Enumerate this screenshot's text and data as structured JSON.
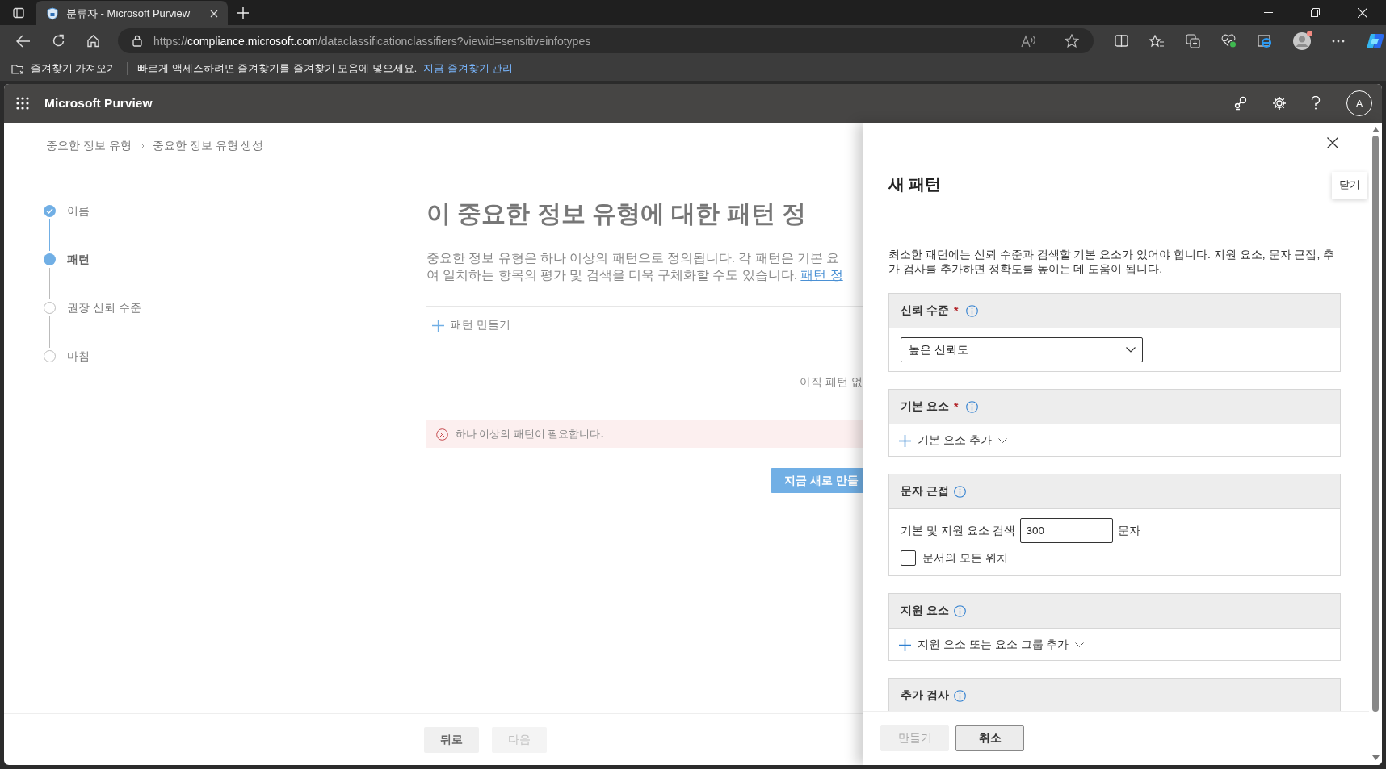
{
  "browser": {
    "tab_title": "분류자 - Microsoft Purview",
    "url_scheme": "https://",
    "url_host": "compliance.microsoft.com",
    "url_path": "/dataclassificationclassifiers?viewid=sensitiveinfotypes",
    "profile_notification": true
  },
  "bookmarks_bar": {
    "import_label": "즐겨찾기 가져오기",
    "message": "빠르게 액세스하려면 즐겨찾기를 즐겨찾기 모음에 넣으세요.",
    "link": "지금 즐겨찾기 관리"
  },
  "app_header": {
    "title": "Microsoft Purview",
    "avatar_initial": "A"
  },
  "breadcrumb": [
    "중요한 정보 유형",
    "중요한 정보 유형 생성"
  ],
  "steps": [
    {
      "label": "이름",
      "completed": true,
      "selected": false
    },
    {
      "label": "패턴",
      "completed": false,
      "selected": true
    },
    {
      "label": "권장 신뢰 수준",
      "completed": false,
      "selected": false
    },
    {
      "label": "마침",
      "completed": false,
      "selected": false
    }
  ],
  "main": {
    "heading": "이 중요한 정보 유형에 대한 패턴 정",
    "description_lines": [
      "중요한 정보 유형은 하나 이상의 패턴으로 정의됩니다. 각 패턴은 기본 요",
      "여 일치하는 항목의 평가 및 검색을 더욱 구체화할 수도 있습니다. "
    ],
    "description_link": "패턴 정",
    "create_pattern": "패턴 만들기",
    "empty_text": "아직 패턴 없",
    "error": "하나 이상의 패턴이 필요합니다.",
    "create_now_button": "지금 새로 만들"
  },
  "footer_buttons": [
    {
      "label": "뒤로",
      "disabled": false
    },
    {
      "label": "다음",
      "disabled": true
    }
  ],
  "panel": {
    "title": "새 패턴",
    "close_tooltip": "닫기",
    "description": "최소한 패턴에는 신뢰 수준과 검색할 기본 요소가 있어야 합니다. 지원 요소, 문자 근접, 추가 검사를 추가하면 정확도를 높이는 데 도움이 됩니다.",
    "sections": [
      {
        "title": "신뢰 수준",
        "required_mark": "*",
        "kind": "dropdown",
        "value": "높은 신뢰도"
      },
      {
        "title": "기본 요소",
        "required_mark": "*",
        "kind": "add",
        "label": "기본 요소 추가"
      },
      {
        "title": "문자 근접",
        "kind": "proximity",
        "prefix": "기본 및 지원 요소 검색",
        "value": "300",
        "suffix": "문자",
        "checkbox_label": "문서의 모든 위치",
        "checked": false
      },
      {
        "title": "지원 요소",
        "kind": "add",
        "label": "지원 요소 또는 요소 그룹 추가"
      },
      {
        "title": "추가 검사",
        "kind": "empty"
      }
    ],
    "buttons": [
      {
        "label": "만들기",
        "disabled": true
      },
      {
        "label": "취소",
        "disabled": false
      }
    ]
  }
}
